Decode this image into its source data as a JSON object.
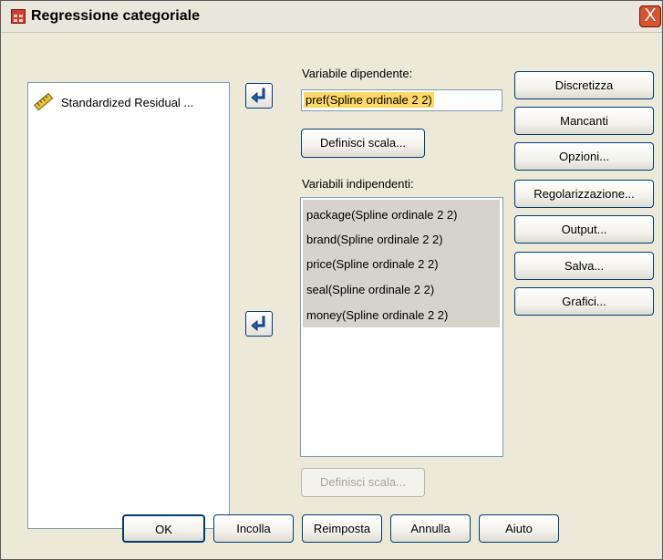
{
  "window": {
    "title": "Regressione categoriale",
    "close_label": "X"
  },
  "source_list": {
    "items": [
      "Standardized Residual ..."
    ]
  },
  "dependent": {
    "label": "Variabile dipendente:",
    "value": "pref(Spline ordinale 2 2)",
    "define_scale_label": "Definisci scala..."
  },
  "independent": {
    "label": "Variabili indipendenti:",
    "items": [
      "package(Spline ordinale 2 2)",
      "brand(Spline ordinale 2 2)",
      "price(Spline ordinale 2 2)",
      "seal(Spline ordinale 2 2)",
      "money(Spline ordinale 2 2)"
    ],
    "define_scale_label": "Definisci scala..."
  },
  "side_buttons": [
    "Discretizza",
    "Mancanti",
    "Opzioni...",
    "Regolarizzazione...",
    "Output...",
    "Salva...",
    "Grafici..."
  ],
  "bottom_buttons": [
    "OK",
    "Incolla",
    "Reimposta",
    "Annulla",
    "Aiuto"
  ],
  "colors": {
    "dialog_bg": "#ece9d8",
    "selection_highlight": "#ffd964",
    "selected_list_bg": "#d5d3cc",
    "close_button": "#d8522d"
  }
}
